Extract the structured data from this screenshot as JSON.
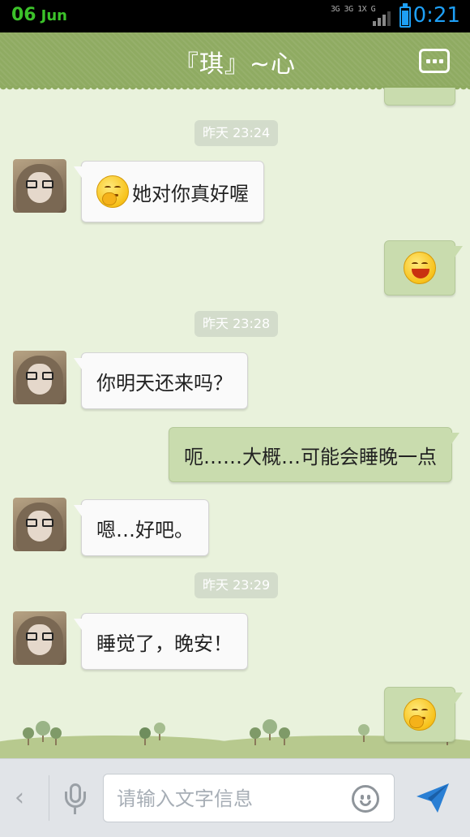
{
  "status_bar": {
    "date_day": "06",
    "date_month": "Jun",
    "network": "3G 3G 1X G",
    "time": "0:21",
    "colors": {
      "date": "#3cc22a",
      "clock": "#1e9ff5"
    }
  },
  "header": {
    "title": "『琪』~心",
    "menu_icon": "more-dots-icon",
    "color": "#8fab62"
  },
  "conversation": {
    "timestamps": [
      "昨天 23:24",
      "昨天 23:28",
      "昨天 23:29"
    ],
    "messages": [
      {
        "sender": "contact",
        "emoji": "thinking-face",
        "text": "她对你真好喔"
      },
      {
        "sender": "self",
        "emoji": "grinning-face",
        "text": ""
      },
      {
        "sender": "contact",
        "text": "你明天还来吗？"
      },
      {
        "sender": "self",
        "text": "呃……大概…可能会睡晚一点"
      },
      {
        "sender": "contact",
        "text": "嗯…好吧。"
      },
      {
        "sender": "contact",
        "text": "睡觉了，晚安！"
      },
      {
        "sender": "self",
        "emoji": "thinking-face",
        "text": ""
      }
    ]
  },
  "input_bar": {
    "placeholder": "请输入文字信息",
    "icons": [
      "back-chevron-icon",
      "microphone-icon",
      "smiley-icon",
      "send-icon"
    ]
  }
}
